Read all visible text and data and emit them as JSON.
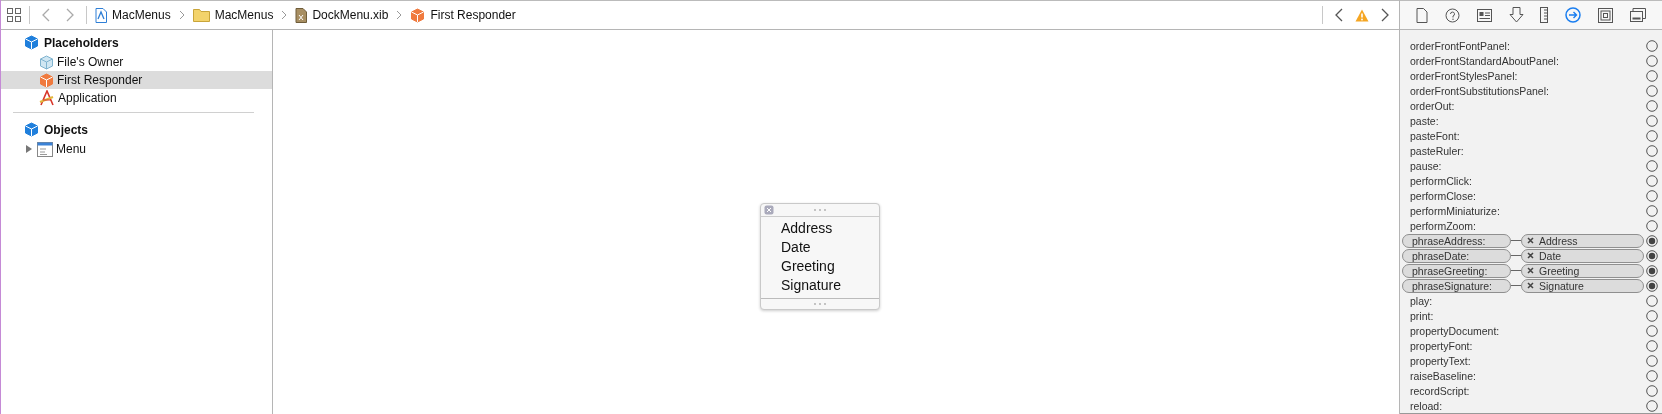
{
  "breadcrumb": [
    {
      "kind": "project",
      "label": "MacMenus"
    },
    {
      "kind": "folder",
      "label": "MacMenus"
    },
    {
      "kind": "xib",
      "label": "DockMenu.xib"
    },
    {
      "kind": "responder",
      "label": "First Responder"
    }
  ],
  "inspector_tabs": [
    {
      "kind": "file",
      "selected": false
    },
    {
      "kind": "help",
      "selected": false
    },
    {
      "kind": "identity",
      "selected": false
    },
    {
      "kind": "attributes",
      "selected": false
    },
    {
      "kind": "size",
      "selected": false
    },
    {
      "kind": "connections",
      "selected": true
    },
    {
      "kind": "bindings",
      "selected": false
    },
    {
      "kind": "effects",
      "selected": false
    }
  ],
  "outline": [
    {
      "kind": "section",
      "label": "Placeholders",
      "children": [
        {
          "kind": "owner",
          "label": "File's Owner",
          "selected": false
        },
        {
          "kind": "responder",
          "label": "First Responder",
          "selected": true
        },
        {
          "kind": "application",
          "label": "Application",
          "selected": false
        }
      ]
    },
    {
      "kind": "section",
      "label": "Objects",
      "children": [
        {
          "kind": "menu",
          "label": "Menu",
          "selected": false,
          "expanded": false
        }
      ]
    }
  ],
  "menu_window": {
    "items": [
      "Address",
      "Date",
      "Greeting",
      "Signature"
    ]
  },
  "actions": [
    {
      "name": "orderFrontFontPanel:",
      "connected": false
    },
    {
      "name": "orderFrontStandardAboutPanel:",
      "connected": false
    },
    {
      "name": "orderFrontStylesPanel:",
      "connected": false
    },
    {
      "name": "orderFrontSubstitutionsPanel:",
      "connected": false
    },
    {
      "name": "orderOut:",
      "connected": false
    },
    {
      "name": "paste:",
      "connected": false
    },
    {
      "name": "pasteFont:",
      "connected": false
    },
    {
      "name": "pasteRuler:",
      "connected": false
    },
    {
      "name": "pause:",
      "connected": false
    },
    {
      "name": "performClick:",
      "connected": false
    },
    {
      "name": "performClose:",
      "connected": false
    },
    {
      "name": "performMiniaturize:",
      "connected": false
    },
    {
      "name": "performZoom:",
      "connected": false
    },
    {
      "name": "phraseAddress:",
      "connected": true,
      "target": "Address"
    },
    {
      "name": "phraseDate:",
      "connected": true,
      "target": "Date"
    },
    {
      "name": "phraseGreeting:",
      "connected": true,
      "target": "Greeting"
    },
    {
      "name": "phraseSignature:",
      "connected": true,
      "target": "Signature"
    },
    {
      "name": "play:",
      "connected": false
    },
    {
      "name": "print:",
      "connected": false
    },
    {
      "name": "propertyDocument:",
      "connected": false
    },
    {
      "name": "propertyFont:",
      "connected": false
    },
    {
      "name": "propertyText:",
      "connected": false
    },
    {
      "name": "raiseBaseline:",
      "connected": false
    },
    {
      "name": "recordScript:",
      "connected": false
    },
    {
      "name": "reload:",
      "connected": false
    }
  ]
}
